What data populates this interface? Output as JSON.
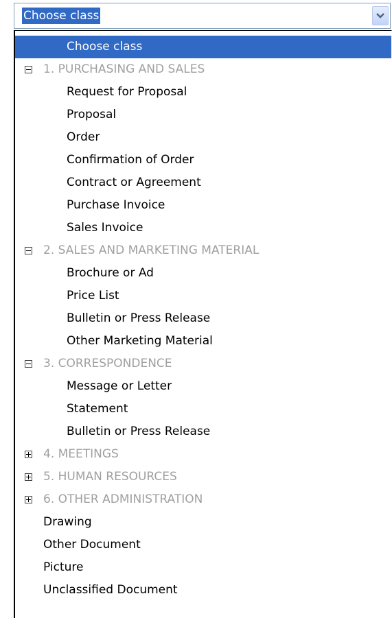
{
  "combo": {
    "value": "Choose class",
    "dropdown_icon": "chevron-down-icon"
  },
  "list": {
    "selected": "Choose class",
    "groups": [
      {
        "label": "1. PURCHASING AND SALES",
        "state": "expanded",
        "items": [
          "Request for Proposal",
          "Proposal",
          "Order",
          "Confirmation of Order",
          "Contract or Agreement",
          "Purchase Invoice",
          "Sales Invoice"
        ]
      },
      {
        "label": "2. SALES AND MARKETING MATERIAL",
        "state": "expanded",
        "items": [
          "Brochure or Ad",
          "Price List",
          "Bulletin or Press Release",
          "Other Marketing Material"
        ]
      },
      {
        "label": "3. CORRESPONDENCE",
        "state": "expanded",
        "items": [
          "Message or Letter",
          "Statement",
          "Bulletin or Press Release"
        ]
      },
      {
        "label": "4. MEETINGS",
        "state": "collapsed",
        "items": []
      },
      {
        "label": "5. HUMAN RESOURCES",
        "state": "collapsed",
        "items": []
      },
      {
        "label": "6. OTHER ADMINISTRATION",
        "state": "collapsed",
        "items": []
      }
    ],
    "ungrouped": [
      "Drawing",
      "Other Document",
      "Picture",
      "Unclassified Document"
    ]
  },
  "colors": {
    "selection": "#316ac5",
    "group_text": "#a0a0a0",
    "border": "#7f9db9"
  }
}
